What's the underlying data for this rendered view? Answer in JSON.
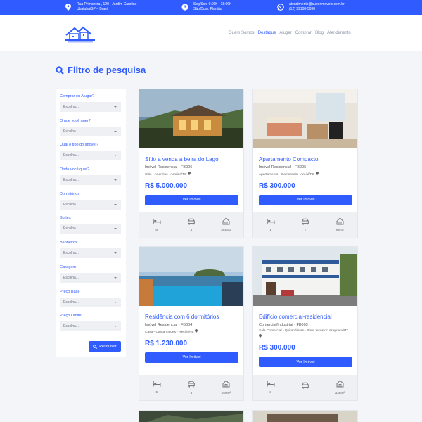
{
  "topbar": {
    "address_line1": "Rua Primavera , 120 - Jardim Carolina",
    "address_line2": "Ubatuba/SP – Brasil",
    "hours_line1": "Seg/Sex: 9:00h - 18:00h",
    "hours_line2": "Sáb/Dom: Plantão",
    "email": "atendimento@superimoveis.com.br",
    "phone": "(12) 99138-5030"
  },
  "nav": {
    "items": [
      "Quem Somos",
      "Destaque",
      "Alugar",
      "Comprar",
      "Blog",
      "Atendimento"
    ],
    "active": "Destaque"
  },
  "filter": {
    "title": "Filtro de pesquisa",
    "fields": [
      {
        "label": "Comprar ou Alugar?",
        "value": "Escolha..."
      },
      {
        "label": "O que você quer?",
        "value": "Escolha..."
      },
      {
        "label": "Qual o tipo do imóvel?",
        "value": "Escolha..."
      },
      {
        "label": "Onde você quer?",
        "value": "Escolha..."
      },
      {
        "label": "Dormitórios",
        "value": "Escolha..."
      },
      {
        "label": "Suítes",
        "value": "Escolha..."
      },
      {
        "label": "Banheiros",
        "value": "Escolha..."
      },
      {
        "label": "Garagem",
        "value": "Escolha..."
      },
      {
        "label": "Preço Base",
        "value": "Escolha..."
      },
      {
        "label": "Preço Limite",
        "value": "Escolha..."
      }
    ],
    "search_label": "Pesquisar"
  },
  "listings": [
    {
      "title": "Sítio a venda a beira do Lago",
      "type": "Imóvel Residencial - FB006",
      "location": "Sítio - Andrelas - Arraias/TO",
      "price": "R$ 5.000.000",
      "button": "Ver Imóvel",
      "beds": "6",
      "garage": "6",
      "area": "650m²"
    },
    {
      "title": "Apartamento Compacto",
      "type": "Imóvel Residencial - FB005",
      "location": "Apartamento - Camaraolo - Areial/PB",
      "price": "R$ 300.000",
      "button": "Ver Imóvel",
      "beds": "1",
      "garage": "1",
      "area": "55m²"
    },
    {
      "title": "Residência com 6 dormitórios",
      "type": "Imóvel Residencial - FB004",
      "location": "Casa - Cantanhedes - Recife/PE",
      "price": "R$ 1.230.000",
      "button": "Ver Imóvel",
      "beds": "6",
      "garage": "3",
      "area": "250m²"
    },
    {
      "title": "Edifício comercial-residencial",
      "type": "Comercial/Industrial - FB003",
      "location": "Sala Comercial - Quitandeiras - Bom Jesus do Araguaia/MT",
      "price": "R$ 300.000",
      "button": "Ver Imóvel",
      "beds": "8",
      "garage": "",
      "area": "338m²"
    }
  ],
  "colors": {
    "accent": "#2f5bff",
    "panel": "#eef0f4",
    "background": "#f4f5f8"
  }
}
